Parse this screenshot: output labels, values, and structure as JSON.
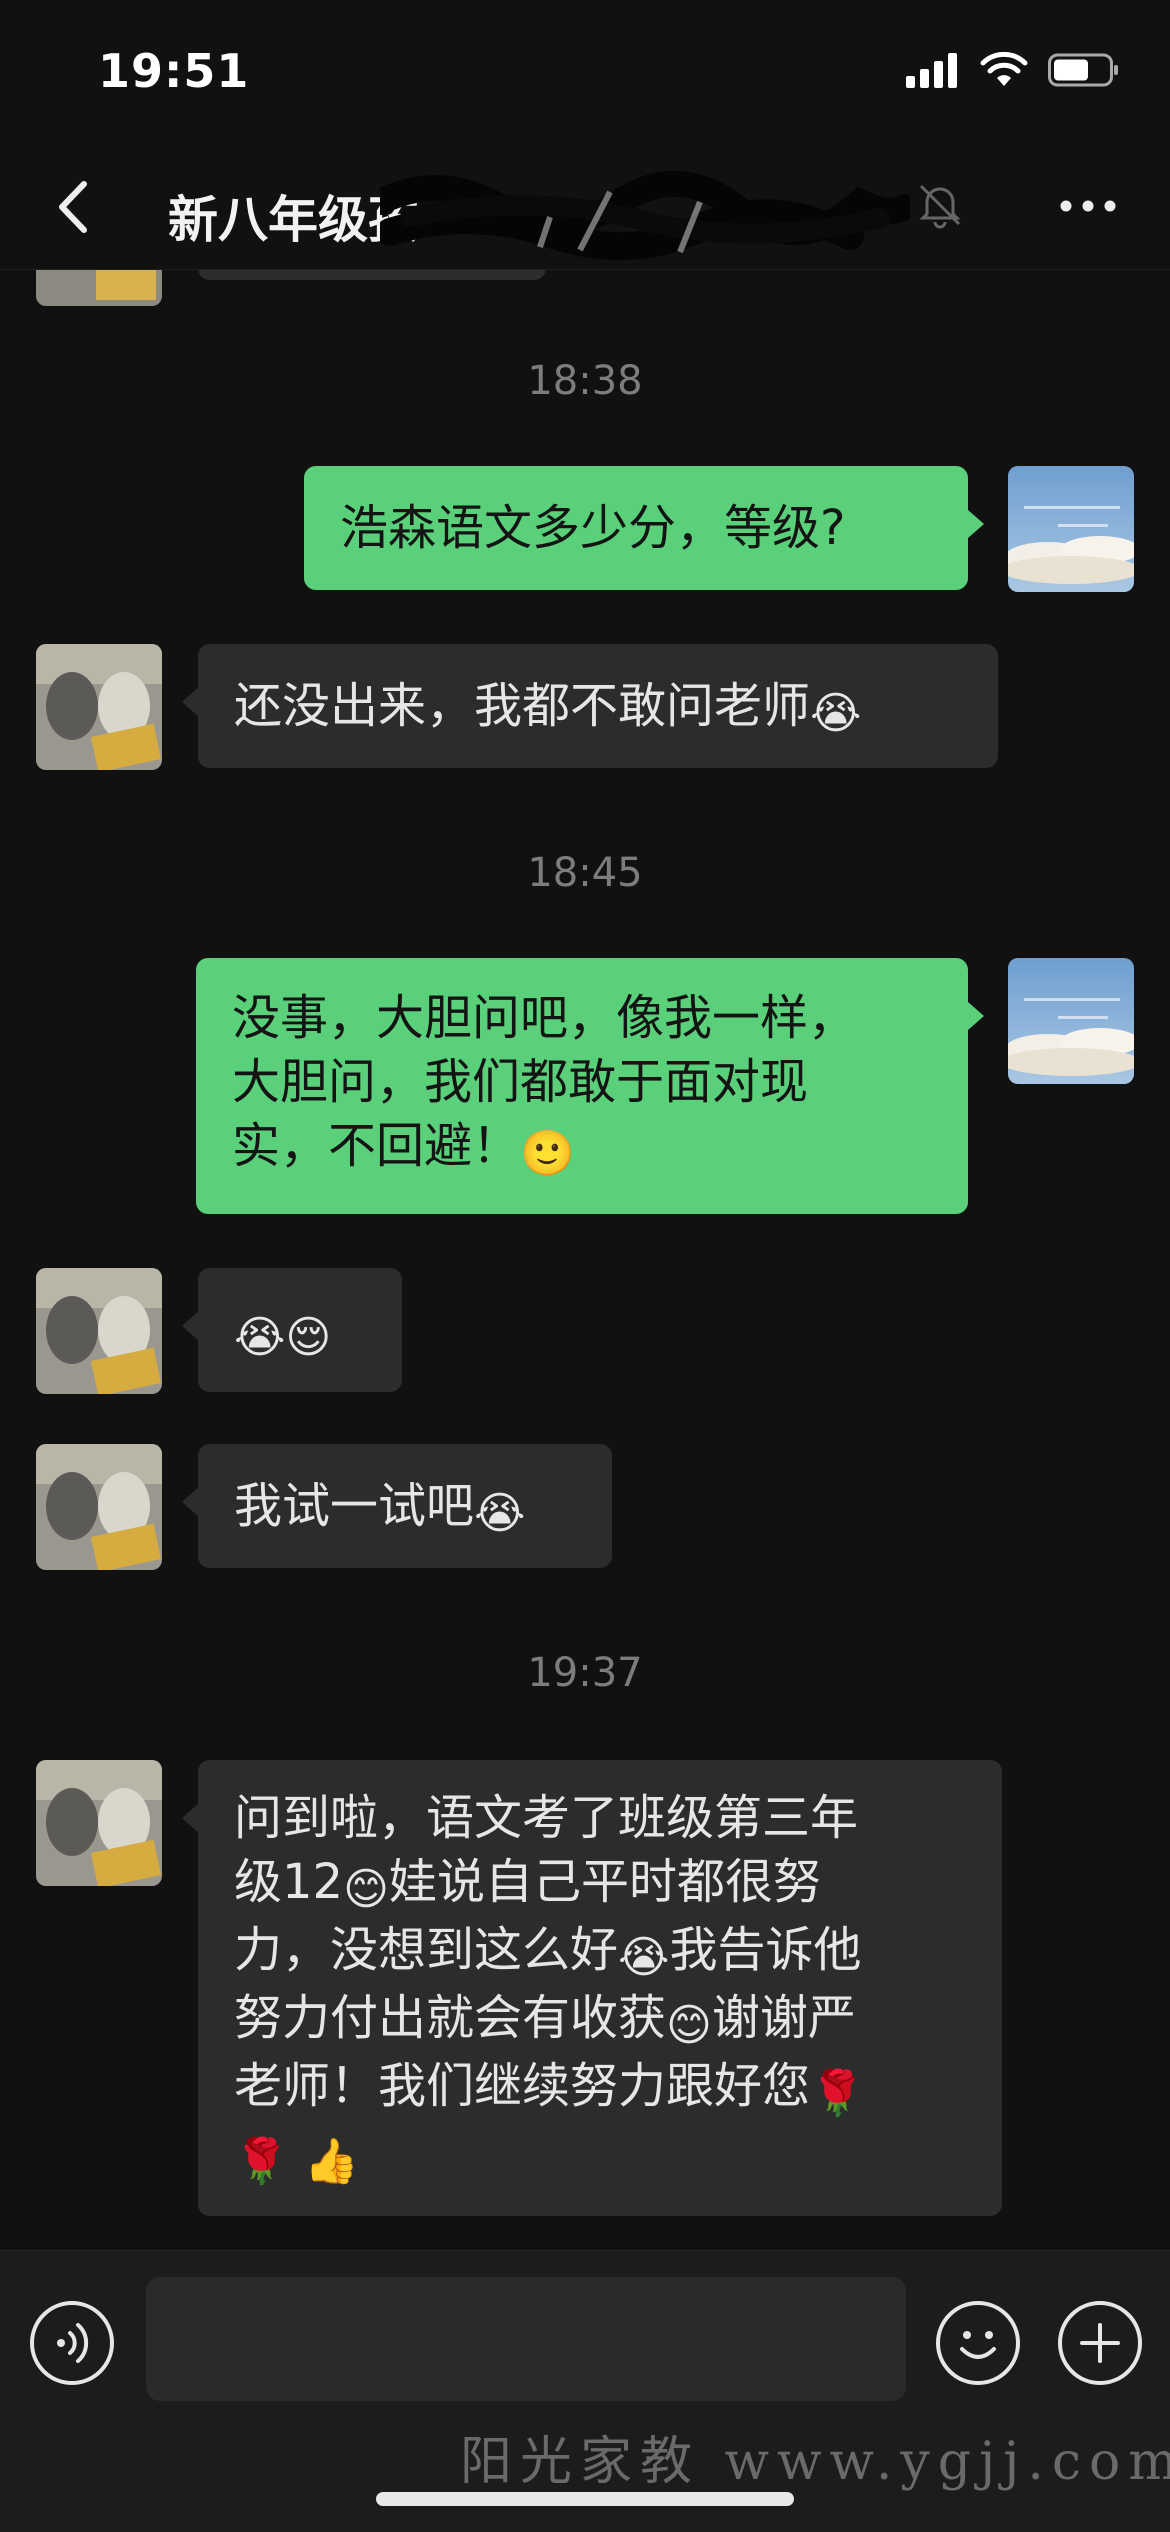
{
  "status_bar": {
    "time": "19:51"
  },
  "header": {
    "title": "新八年级孩"
  },
  "messages": [
    {
      "timestamp": "18:38"
    },
    {
      "text": "浩森语文多少分，等级?"
    },
    {
      "text": "还没出来，我都不敢问老师",
      "emoji": "😭"
    },
    {
      "timestamp": "18:45"
    },
    {
      "text_line1": "没事，大胆问吧，像我一样，",
      "text_line2": "大胆问，我们都敢于面对现",
      "text_line3": "实，不回避！",
      "emoji": "🙂"
    },
    {
      "emoji": "😭😌"
    },
    {
      "text": "我试一试吧",
      "emoji": "😭"
    },
    {
      "timestamp": "19:37"
    },
    {
      "l1": "问到啦，语文考了班级第三年",
      "l2a": "级12",
      "e1": "😊",
      "l2b": "娃说自己平时都很努",
      "l3a": "力，没想到这么好",
      "e2": "😭",
      "l3b": "我告诉他",
      "l4a": "努力付出就会有收获",
      "e3": "😊",
      "l4b": "谢谢严",
      "l5": "老师！我们继续努力跟好您",
      "e4": "🌹",
      "e5": "🌹",
      "e6": "👍"
    }
  ],
  "watermark": "阳光家教 www.ygjj.com",
  "icons": {
    "back": "chevron-left-icon",
    "mute": "bell-off-icon",
    "more": "ellipsis-icon",
    "voice": "voice-icon",
    "emoji": "smiley-icon",
    "add": "plus-circle-icon"
  },
  "colors": {
    "outgoing_bubble": "#5bd07a",
    "incoming_bubble": "#2c2c2c",
    "background": "#111111"
  }
}
